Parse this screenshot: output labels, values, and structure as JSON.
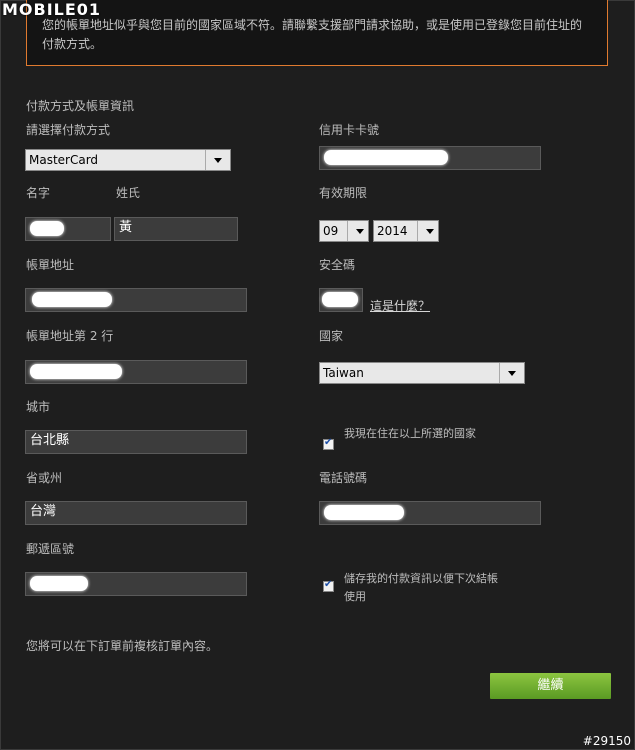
{
  "watermark": "MOBILE01",
  "corner_id": "#29150",
  "warning_text": "您的帳單地址似乎與您目前的國家區域不符。請聯繫支援部門請求協助，或是使用已登錄您目前住址的付款方式。",
  "section_title": "付款方式及帳單資訊",
  "labels": {
    "payment_method": "請選擇付款方式",
    "card_number": "信用卡卡號",
    "first_name": "名字",
    "last_name": "姓氏",
    "expiry": "有效期限",
    "billing_address": "帳單地址",
    "security_code": "安全碼",
    "billing_address_2": "帳單地址第 2 行",
    "country": "國家",
    "city": "城市",
    "province": "省或州",
    "phone": "電話號碼",
    "postal_code": "郵遞區號"
  },
  "values": {
    "payment_method": "MasterCard",
    "last_name": "黃",
    "expiry_month": "09",
    "expiry_year": "2014",
    "country": "Taiwan",
    "city": "台北縣",
    "province": "台灣"
  },
  "what_is_this_link": "這是什麼？",
  "checkbox_residence": "我現在住在以上所選的國家",
  "checkbox_save_line1": "儲存我的付款資訊以便下次結帳",
  "checkbox_save_line2": "使用",
  "review_note": "您將可以在下訂單前複核訂單內容。",
  "continue_button": "繼續"
}
